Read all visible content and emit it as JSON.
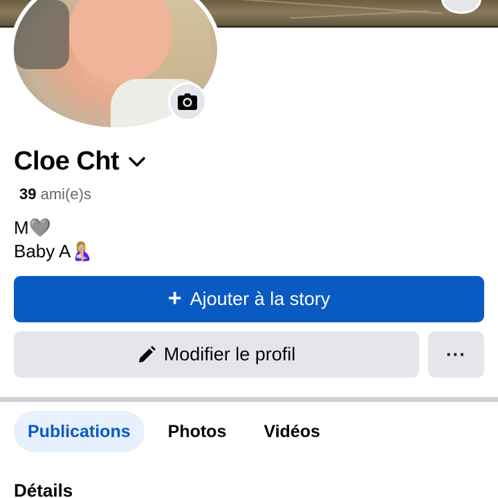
{
  "profile": {
    "name": "Cloe Cht",
    "friends_count": "39",
    "friends_label": "ami(e)s",
    "bio_line1": "M🩶",
    "bio_line2": "Baby A🤱🏼"
  },
  "actions": {
    "add_story_icon": "+",
    "add_story_label": "Ajouter à la story",
    "edit_profile_label": "Modifier le profil",
    "more_label": "···"
  },
  "tabs": [
    {
      "label": "Publications",
      "active": true
    },
    {
      "label": "Photos",
      "active": false
    },
    {
      "label": "Vidéos",
      "active": false
    }
  ],
  "section": {
    "details_title": "Détails"
  },
  "icons": {
    "camera": "camera-icon",
    "chevron": "chevron-down-icon",
    "pencil": "pencil-icon",
    "plus": "plus-icon"
  },
  "colors": {
    "primary": "#0a5ac4",
    "secondary_button": "#e4e6eb",
    "tab_active_bg": "#e7f0fd",
    "muted_text": "#65676b"
  }
}
